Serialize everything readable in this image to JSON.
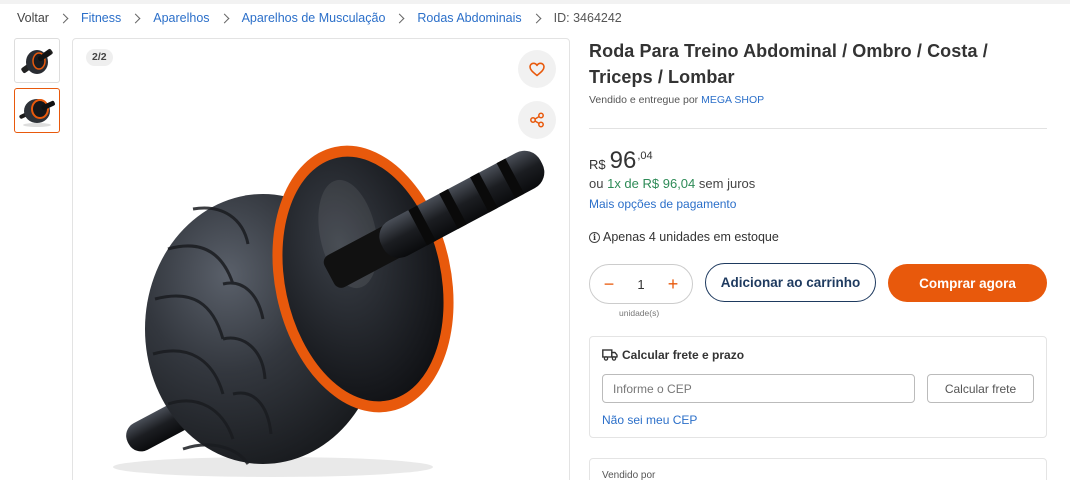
{
  "breadcrumb": {
    "back": "Voltar",
    "items": [
      "Fitness",
      "Aparelhos",
      "Aparelhos de Musculação",
      "Rodas Abdominais"
    ],
    "id": "ID: 3464242"
  },
  "gallery": {
    "counter": "2/2",
    "thumbnails": [
      "ab-wheel-thumb-1",
      "ab-wheel-thumb-2"
    ],
    "selected_index": 1,
    "accent_color": "#e8590c"
  },
  "product": {
    "title": "Roda Para Treino Abdominal / Ombro / Costa / Triceps / Lombar",
    "seller_prefix": "Vendido e entregue por",
    "seller_name": "MEGA SHOP"
  },
  "price": {
    "currency": "R$",
    "integer": "96",
    "cents": ",04",
    "installments_prefix": "ou",
    "installments_highlight": "1x de R$ 96,04",
    "installments_suffix": "sem juros",
    "more_payment": "Mais opções de pagamento"
  },
  "stock": {
    "text": "Apenas 4 unidades em estoque"
  },
  "quantity": {
    "value": "1",
    "unit": "unidade(s)"
  },
  "actions": {
    "add_to_cart": "Adicionar ao carrinho",
    "buy_now": "Comprar agora"
  },
  "freight": {
    "title": "Calcular frete e prazo",
    "placeholder": "Informe o CEP",
    "calc_button": "Calcular frete",
    "no_cep": "Não sei meu CEP"
  },
  "sold_by": {
    "label": "Vendido por"
  },
  "colors": {
    "accent": "#e8590c",
    "link": "#2b6fc9",
    "navy": "#1e3a5f",
    "green": "#2e8b57"
  }
}
